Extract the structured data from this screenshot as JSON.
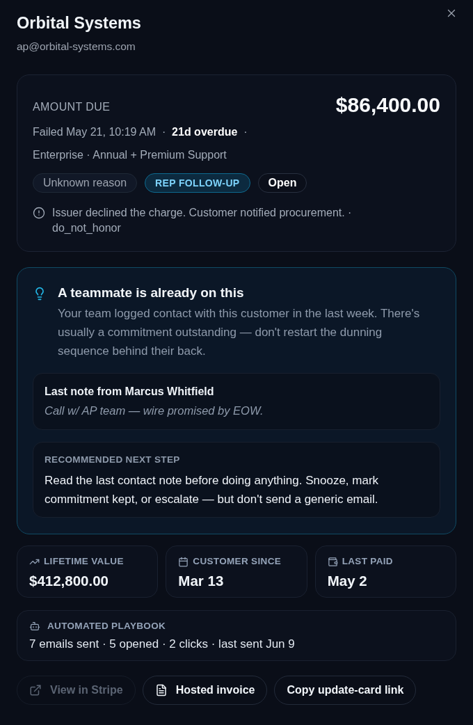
{
  "header": {
    "title": "Orbital Systems",
    "email": "ap@orbital-systems.com"
  },
  "amount_card": {
    "label": "AMOUNT DUE",
    "amount": "$86,400.00",
    "status_line": "Failed May 21, 10:19 AM  ·  **21d overdue**  ·",
    "plan": "Enterprise · Annual + Premium Support",
    "badges": [
      {
        "label": "Unknown reason",
        "kind": "neutral"
      },
      {
        "label": "REP FOLLOW-UP",
        "kind": "tag"
      },
      {
        "label": "Open",
        "kind": "status"
      }
    ],
    "decline_note": "Issuer declined the charge. Customer notified procurement. · do_not_honor"
  },
  "teammate_card": {
    "title": "A teammate is already on this",
    "body": "Your team logged contact with this customer in the last week. There's usually a commitment outstanding — don't restart the dunning sequence behind their back.",
    "last_note": {
      "title": "Last note from Marcus Whitfield",
      "text": "Call w/ AP team — wire promised by EOW."
    },
    "next_step": {
      "label": "RECOMMENDED NEXT STEP",
      "text": "Read the last contact note before doing anything. Snooze, mark commitment kept, or escalate — but don't send a generic email."
    }
  },
  "stats": [
    {
      "label": "LIFETIME VALUE",
      "value": "$412,800.00"
    },
    {
      "label": "CUSTOMER SINCE",
      "value": "Mar 13"
    },
    {
      "label": "LAST PAID",
      "value": "May 2"
    }
  ],
  "playbook": {
    "label": "AUTOMATED PLAYBOOK",
    "summary": "7 emails sent · 5 opened · 2 clicks · last sent Jun 9"
  },
  "actions": [
    {
      "label": "View in Stripe",
      "disabled": true
    },
    {
      "label": "Hosted invoice",
      "disabled": false
    },
    {
      "label": "Copy update-card link",
      "disabled": false
    }
  ]
}
